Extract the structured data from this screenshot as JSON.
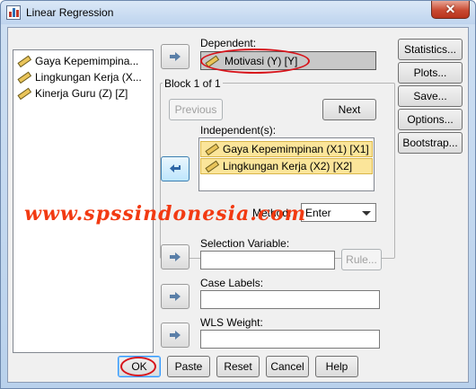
{
  "window": {
    "title": "Linear Regression",
    "close_glyph": "✕"
  },
  "variables": [
    {
      "label": "Gaya Kepemimpina...",
      "icon": "scale-ruler-icon"
    },
    {
      "label": "Lingkungan Kerja (X...",
      "icon": "scale-ruler-icon"
    },
    {
      "label": "Kinerja Guru (Z) [Z]",
      "icon": "scale-ruler-icon"
    }
  ],
  "dependent": {
    "label": "Dependent:",
    "value": "Motivasi (Y) [Y]"
  },
  "block": {
    "title": "Block 1 of 1",
    "previous_label": "Previous",
    "next_label": "Next",
    "independents_label": "Independent(s):",
    "independents": [
      "Gaya Kepemimpinan (X1) [X1]",
      "Lingkungan Kerja (X2) [X2]"
    ],
    "method_label": "Method:",
    "method_value": "Enter"
  },
  "selection_variable": {
    "label": "Selection Variable:",
    "value": "",
    "rule_label": "Rule..."
  },
  "case_labels": {
    "label": "Case Labels:",
    "value": ""
  },
  "wls_weight": {
    "label": "WLS Weight:",
    "value": ""
  },
  "side_buttons": [
    "Statistics...",
    "Plots...",
    "Save...",
    "Options...",
    "Bootstrap..."
  ],
  "bottom_buttons": [
    "OK",
    "Paste",
    "Reset",
    "Cancel",
    "Help"
  ],
  "watermark": "www.spssindonesia.com",
  "colors": {
    "highlight": "#fbe59a",
    "annotation_red": "#d7141b",
    "watermark": "#f23a12"
  }
}
